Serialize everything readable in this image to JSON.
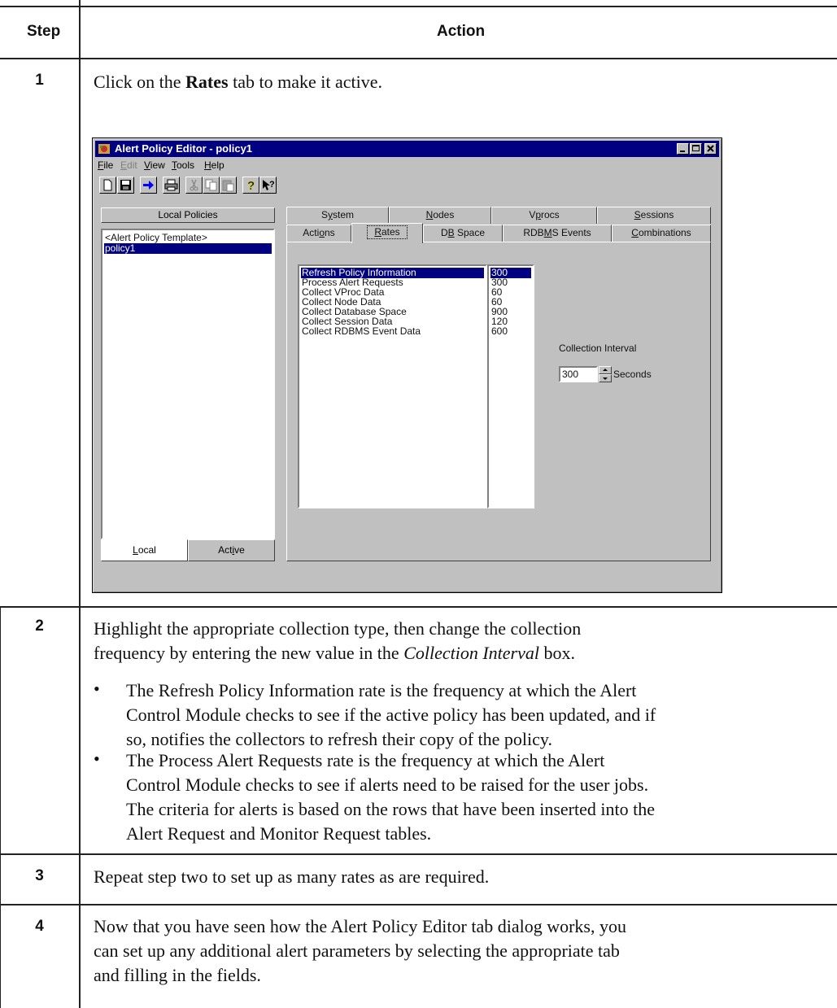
{
  "table": {
    "headers": {
      "step": "Step",
      "action": "Action"
    },
    "steps": [
      {
        "num": "1",
        "text_pre": "Click on the ",
        "text_bold": "Rates",
        "text_post": " tab to make it active."
      },
      {
        "num": "2",
        "line1": "Highlight the appropriate collection type, then change the collection",
        "line2_pre": "frequency by entering the new value in the ",
        "line2_italic": "Collection Interval",
        "line2_post": " box.",
        "bullets": [
          {
            "lines": [
              "The Refresh Policy Information rate is the frequency at which the Alert",
              "Control Module checks to see if the active policy has been updated, and if",
              "so, notifies the collectors to refresh their copy of the policy."
            ]
          },
          {
            "lines": [
              "The Process Alert Requests rate is the frequency at which the Alert",
              "Control Module checks to see if alerts need to be raised for the user jobs.",
              "The criteria for alerts is based on the rows that have been inserted into the",
              "Alert Request and Monitor Request tables."
            ]
          }
        ]
      },
      {
        "num": "3",
        "text": "Repeat step two to set up as many rates as are required."
      },
      {
        "num": "4",
        "lines": [
          "Now that you have seen how the Alert Policy Editor tab dialog works, you",
          "can set up any additional alert parameters by selecting the appropriate tab",
          "and filling in the fields."
        ]
      }
    ]
  },
  "window": {
    "title": "Alert Policy Editor - policy1",
    "menu": [
      "File",
      "Edit",
      "View",
      "Tools",
      "Help"
    ],
    "left_panel": {
      "header": "Local Policies",
      "items": [
        "<Alert Policy Template>",
        "policy1"
      ],
      "selected_index": 1,
      "buttons": [
        "Local",
        "Active"
      ]
    },
    "tabs_row1": [
      "System",
      "Nodes",
      "Vprocs",
      "Sessions"
    ],
    "tabs_row2": [
      "Actions",
      "Rates",
      "DB Space",
      "RDBMS Events",
      "Combinations"
    ],
    "active_tab": "Rates",
    "rates": [
      {
        "name": "Refresh Policy Information",
        "value": "300"
      },
      {
        "name": "Process Alert Requests",
        "value": "300"
      },
      {
        "name": "Collect VProc Data",
        "value": "60"
      },
      {
        "name": "Collect Node Data",
        "value": "60"
      },
      {
        "name": "Collect Database Space",
        "value": "900"
      },
      {
        "name": "Collect Session Data",
        "value": "120"
      },
      {
        "name": "Collect RDBMS Event Data",
        "value": "600"
      }
    ],
    "selected_rate_index": 0,
    "collection_interval": {
      "label": "Collection Interval",
      "value": "300",
      "unit": "Seconds"
    }
  }
}
